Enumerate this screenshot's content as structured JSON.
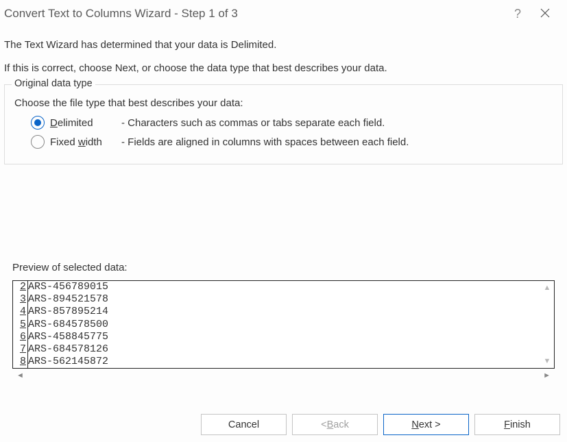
{
  "title": "Convert Text to Columns Wizard - Step 1 of 3",
  "intro": {
    "line1": "The Text Wizard has determined that your data is Delimited.",
    "line2": "If this is correct, choose Next, or choose the data type that best describes your data."
  },
  "fieldset": {
    "legend": "Original data type",
    "choose": "Choose the file type that best describes your data:",
    "delimited": {
      "label_pre": "D",
      "label_post": "elimited",
      "desc": "- Characters such as commas or tabs separate each field.",
      "checked": true
    },
    "fixed": {
      "label_pre": "Fixed ",
      "label_u": "w",
      "label_post": "idth",
      "desc": "- Fields are aligned in columns with spaces between each field.",
      "checked": false
    }
  },
  "preview": {
    "label": "Preview of selected data:",
    "rows": [
      {
        "n": "2",
        "v": "ARS-456789015"
      },
      {
        "n": "3",
        "v": "ARS-894521578"
      },
      {
        "n": "4",
        "v": "ARS-857895214"
      },
      {
        "n": "5",
        "v": "ARS-684578500"
      },
      {
        "n": "6",
        "v": "ARS-458845775"
      },
      {
        "n": "7",
        "v": "ARS-684578126"
      },
      {
        "n": "8",
        "v": "ARS-562145872"
      }
    ]
  },
  "buttons": {
    "cancel": "Cancel",
    "back_pre": "< ",
    "back_u": "B",
    "back_post": "ack",
    "next_u": "N",
    "next_post": "ext >",
    "finish_u": "F",
    "finish_post": "inish"
  }
}
